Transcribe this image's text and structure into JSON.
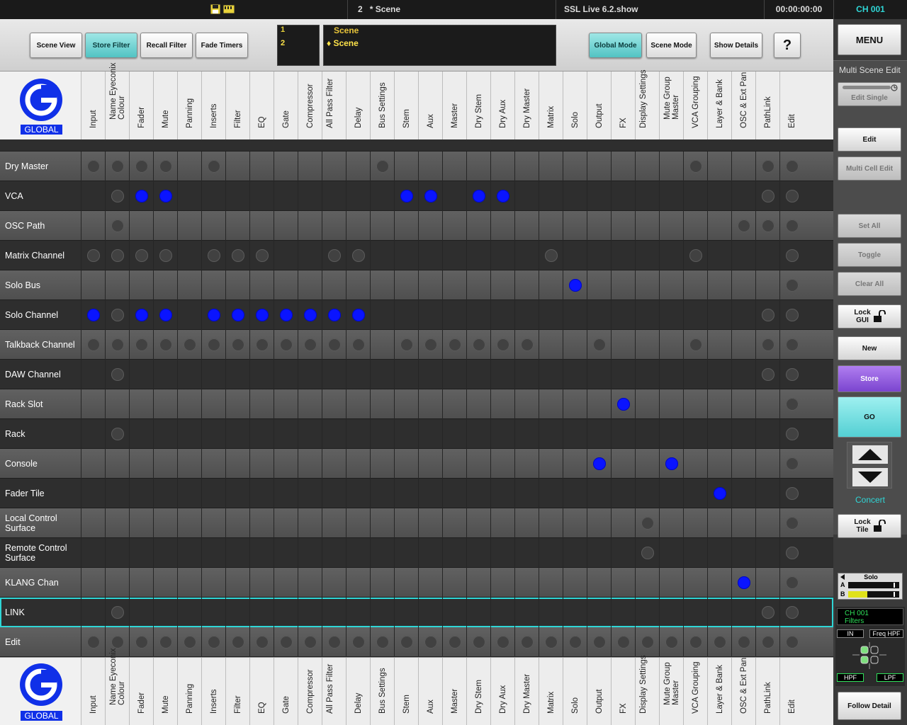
{
  "topbar": {
    "scene_number": "2",
    "scene_name": "* Scene",
    "show_file": "SSL Live 6.2.show",
    "timecode": "00:00:00:00",
    "channel": "CH 001"
  },
  "toolbar": {
    "left_buttons": [
      {
        "label": "Scene View",
        "active": false
      },
      {
        "label": "Store Filter",
        "active": true
      },
      {
        "label": "Recall Filter",
        "active": false
      },
      {
        "label": "Fade Timers",
        "active": false
      }
    ],
    "scene_list": {
      "numbers": [
        "1",
        "2"
      ],
      "names": [
        "Scene",
        "♦ Scene"
      ]
    },
    "right_buttons": [
      {
        "label": "Global Mode",
        "active": true
      },
      {
        "label": "Scene Mode",
        "active": false
      },
      {
        "label": "Show Details",
        "active": false
      }
    ],
    "help_label": "?"
  },
  "logo": {
    "letter": "G",
    "label": "GLOBAL"
  },
  "columns": [
    "Input",
    "Name Eyeconix Colour",
    "Fader",
    "Mute",
    "Panning",
    "Inserts",
    "Filter",
    "EQ",
    "Gate",
    "Compressor",
    "All Pass Filter",
    "Delay",
    "Bus Settings",
    "Stem",
    "Aux",
    "Master",
    "Dry Stem",
    "Dry Aux",
    "Dry Master",
    "Matrix",
    "Solo",
    "Output",
    "FX",
    "Display Settings",
    "Mute Group Master",
    "VCA Grouping",
    "Layer & Bank",
    "OSC & Ext Pan",
    "PathLink",
    "Edit"
  ],
  "rows": [
    {
      "label": "Dry Master",
      "on": [],
      "off": [
        0,
        1,
        2,
        3,
        5,
        12,
        25,
        28,
        29
      ]
    },
    {
      "label": "VCA",
      "on": [
        2,
        3,
        13,
        14,
        16,
        17
      ],
      "off": [
        1,
        28,
        29
      ]
    },
    {
      "label": "OSC Path",
      "on": [],
      "off": [
        1,
        27,
        28,
        29
      ]
    },
    {
      "label": "Matrix Channel",
      "on": [],
      "off": [
        0,
        1,
        2,
        3,
        5,
        6,
        7,
        10,
        11,
        19,
        25,
        29
      ]
    },
    {
      "label": "Solo Bus",
      "on": [
        20
      ],
      "off": [
        29
      ]
    },
    {
      "label": "Solo Channel",
      "on": [
        0,
        2,
        3,
        5,
        6,
        7,
        8,
        9,
        10,
        11
      ],
      "off": [
        1,
        28,
        29
      ]
    },
    {
      "label": "Talkback Channel",
      "on": [],
      "off": [
        0,
        1,
        2,
        3,
        4,
        5,
        6,
        7,
        8,
        9,
        10,
        11,
        13,
        14,
        15,
        16,
        17,
        18,
        21,
        25,
        28,
        29
      ]
    },
    {
      "label": "DAW Channel",
      "on": [],
      "off": [
        1,
        28,
        29
      ]
    },
    {
      "label": "Rack Slot",
      "on": [
        22
      ],
      "off": [
        29
      ]
    },
    {
      "label": "Rack",
      "on": [],
      "off": [
        1,
        29
      ]
    },
    {
      "label": "Console",
      "on": [
        21,
        24
      ],
      "off": [
        29
      ]
    },
    {
      "label": "Fader Tile",
      "on": [
        26
      ],
      "off": [
        29
      ]
    },
    {
      "label": "Local Control Surface",
      "on": [],
      "off": [
        23,
        29
      ]
    },
    {
      "label": "Remote Control Surface",
      "on": [],
      "off": [
        23,
        29
      ]
    },
    {
      "label": "KLANG Chan",
      "on": [
        27
      ],
      "off": [
        29
      ]
    },
    {
      "label": "LINK",
      "on": [],
      "off": [
        1,
        28,
        29
      ],
      "selected": true
    },
    {
      "label": "Edit",
      "on": [],
      "off": [
        0,
        1,
        2,
        3,
        4,
        5,
        6,
        7,
        8,
        9,
        10,
        11,
        12,
        13,
        14,
        15,
        16,
        17,
        18,
        19,
        20,
        21,
        22,
        23,
        24,
        25,
        26,
        27,
        28,
        29
      ]
    }
  ],
  "right_panel": {
    "menu": "MENU",
    "title": "Multi Scene Edit",
    "edit_single": "Edit Single",
    "edit": "Edit",
    "multi_cell_edit": "Multi Cell Edit",
    "set_all": "Set All",
    "toggle": "Toggle",
    "clear_all": "Clear All",
    "lock_gui": "Lock GUI",
    "new": "New",
    "store": "Store",
    "go": "GO",
    "concert": "Concert",
    "lock_tile": "Lock Tile",
    "solo": "Solo",
    "meter_a": "A",
    "meter_b": "B",
    "meter_b_level": 0.38,
    "ch_label": "CH 001",
    "filters_label": "Filters",
    "in_label": "IN",
    "freq_hpf": "Freq HPF",
    "hpf": "HPF",
    "lpf": "LPF",
    "follow_detail": "Follow Detail"
  },
  "colors": {
    "accent": "#2fd6d6",
    "active_dot": "#0a14ff",
    "store": "#8e5bd8",
    "go": "#7de3e6"
  }
}
